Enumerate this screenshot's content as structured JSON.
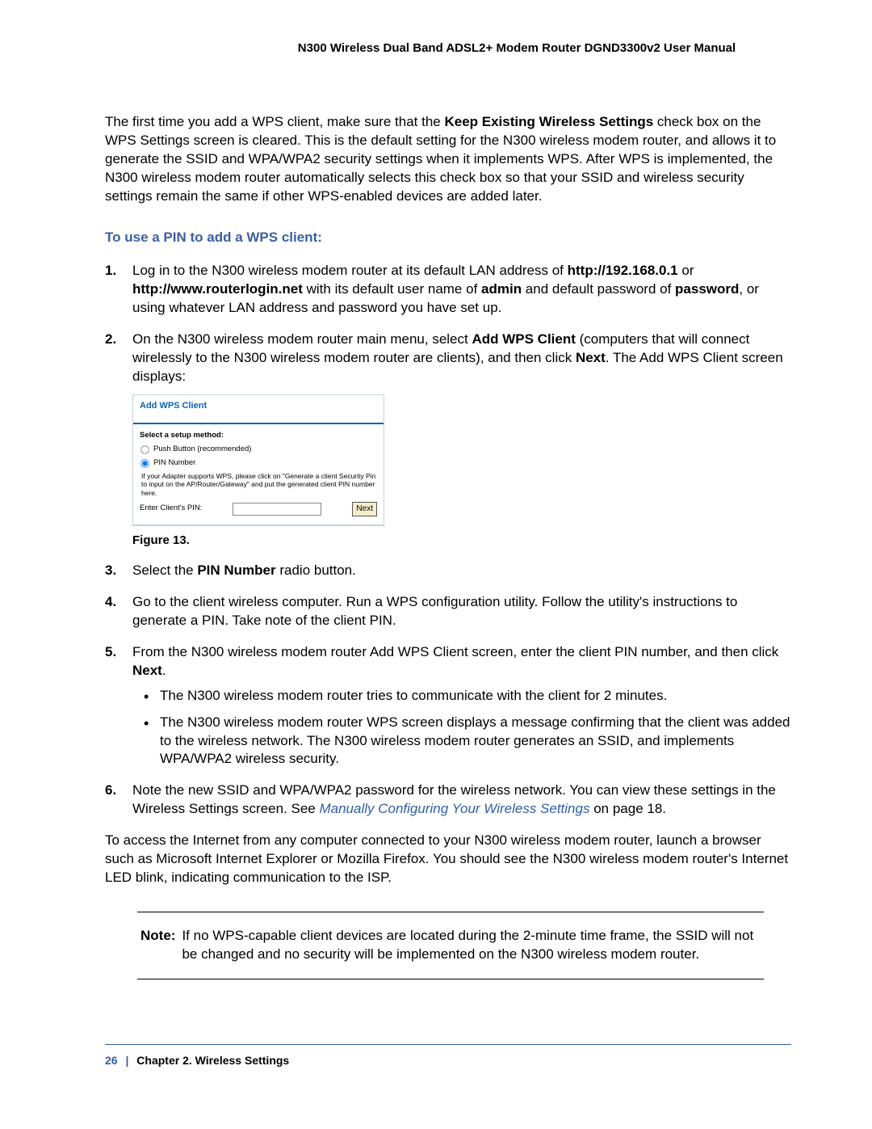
{
  "header": {
    "title": "N300 Wireless Dual Band ADSL2+ Modem Router DGND3300v2 User Manual"
  },
  "intro": {
    "pre": "The first time you add a WPS client, make sure that the ",
    "bold": "Keep Existing Wireless Settings",
    "post": " check box on the WPS Settings screen is cleared. This is the default setting for the N300 wireless modem router, and allows it to generate the SSID and WPA/WPA2 security settings when it implements WPS. After WPS is implemented, the N300 wireless modem router automatically selects this check box so that your SSID and wireless security settings remain the same if other WPS-enabled devices are added later."
  },
  "section_heading": "To use a PIN to add a WPS client:",
  "steps": {
    "s1": {
      "num": "1.",
      "t1": "Log in to the N300 wireless modem router at its default LAN address of ",
      "b1": "http://192.168.0.1",
      "t2": " or ",
      "b2": "http://www.routerlogin.net",
      "t3": " with its default user name of ",
      "b3": "admin",
      "t4": " and default password of ",
      "b4": "password",
      "t5": ", or using whatever LAN address and password you have set up."
    },
    "s2": {
      "num": "2.",
      "t1": "On the N300 wireless modem router main menu, select ",
      "b1": "Add WPS Client",
      "t2": " (computers that will connect wirelessly to the N300 wireless modem router are clients), and then click ",
      "b2": "Next",
      "t3": ". The Add WPS Client screen displays:"
    },
    "s3": {
      "num": "3.",
      "t1": "Select the ",
      "b1": "PIN Number",
      "t2": " radio button."
    },
    "s4": {
      "num": "4.",
      "text": "Go to the client wireless computer. Run a WPS configuration utility. Follow the utility's instructions to generate a PIN. Take note of the client PIN."
    },
    "s5": {
      "num": "5.",
      "t1": "From the N300 wireless modem router Add WPS Client screen, enter the client PIN number, and then click ",
      "b1": "Next",
      "t2": ".",
      "bullets": {
        "b5a": "The N300 wireless modem router tries to communicate with the client for 2 minutes.",
        "b5b": "The N300 wireless modem router WPS screen displays a message confirming that the client was added to the wireless network. The N300 wireless modem router generates an SSID, and implements WPA/WPA2 wireless security."
      }
    },
    "s6": {
      "num": "6.",
      "t1": "Note the new SSID and WPA/WPA2 password for the wireless network. You can view these settings in the Wireless Settings screen. See ",
      "link": "Manually Configuring Your Wireless Settings",
      "t2": " on page 18."
    }
  },
  "figure": {
    "caption": "Figure 13.",
    "screenshot": {
      "title": "Add WPS Client",
      "select_label": "Select a setup method:",
      "opt_push": "Push Button (recommended)",
      "opt_pin": "PIN Number",
      "help": "If your Adapter supports WPS, please click on \"Generate a client Security Pin to input on the AP/Router/Gateway\" and put the generated client PIN number here.",
      "pin_label": "Enter Client's PIN:",
      "next_btn": "Next"
    }
  },
  "closing_para": "To access the Internet from any computer connected to your N300 wireless modem router, launch a browser such as Microsoft Internet Explorer or Mozilla Firefox. You should see the N300 wireless modem router's Internet LED blink, indicating communication to the ISP.",
  "note": {
    "label": "Note:",
    "text": "If no WPS-capable client devices are located during the 2-minute time frame, the SSID will not be changed and no security will be implemented on the N300 wireless modem router."
  },
  "footer": {
    "page": "26",
    "sep": "|",
    "chapter": "Chapter 2.  Wireless Settings"
  }
}
